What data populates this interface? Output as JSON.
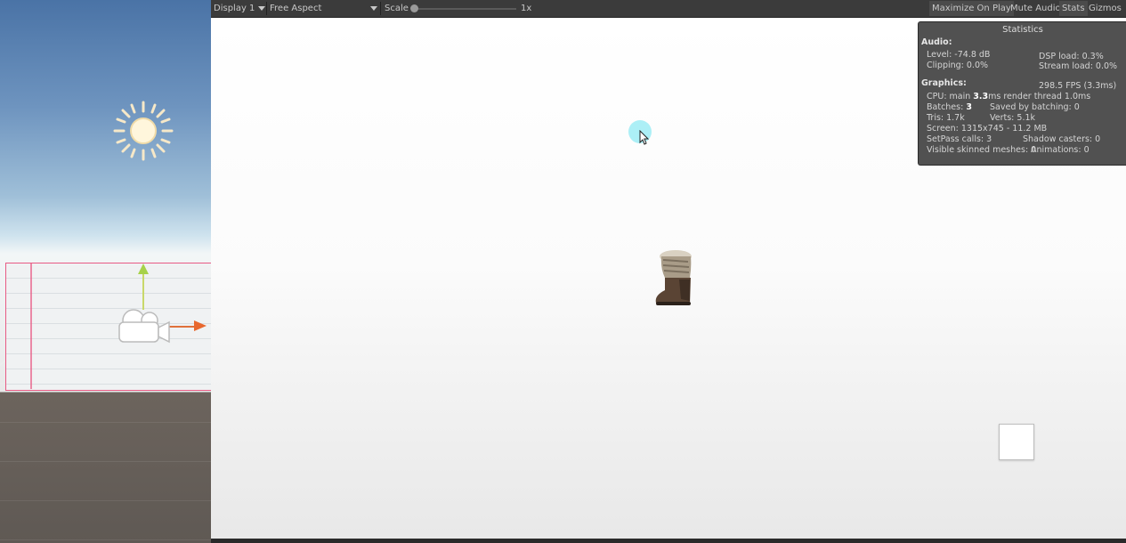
{
  "game_toolbar": {
    "display": "Display 1",
    "aspect": "Free Aspect",
    "scale_label": "Scale",
    "scale_value": "1x",
    "maximize_on_play": "Maximize On Play",
    "mute_audio": "Mute Audio",
    "stats": "Stats",
    "gizmos": "Gizmos"
  },
  "statistics": {
    "title": "Statistics",
    "audio_header": "Audio:",
    "level": "Level: -74.8 dB",
    "clipping": "Clipping: 0.0%",
    "dsp_load": "DSP load: 0.3%",
    "stream_load": "Stream load: 0.0%",
    "graphics_header": "Graphics:",
    "fps": "298.5 FPS (3.3ms)",
    "cpu_prefix": "CPU: main ",
    "cpu_main": "3.3",
    "cpu_suffix": "ms  render thread 1.0ms",
    "batches_prefix": "Batches: ",
    "batches": "3",
    "saved_by_batching": "Saved by batching: 0",
    "tris": "Tris: 1.7k",
    "verts": "Verts: 5.1k",
    "screen": "Screen: 1315x745 - 11.2 MB",
    "setpass": "SetPass calls: 3",
    "shadow_casters": "Shadow casters: 0",
    "visible_skinned": "Visible skinned meshes: 0",
    "animations": "Animations: 0"
  },
  "colors": {
    "toolbar_bg": "#3b3b3b",
    "stats_bg": "#484848",
    "cursor_highlight": "#9eecf4",
    "camera_frustum": "#e85b84"
  },
  "icons": [
    "sun-icon",
    "camera-icon",
    "cursor-icon",
    "dropdown-arrow-icon"
  ]
}
